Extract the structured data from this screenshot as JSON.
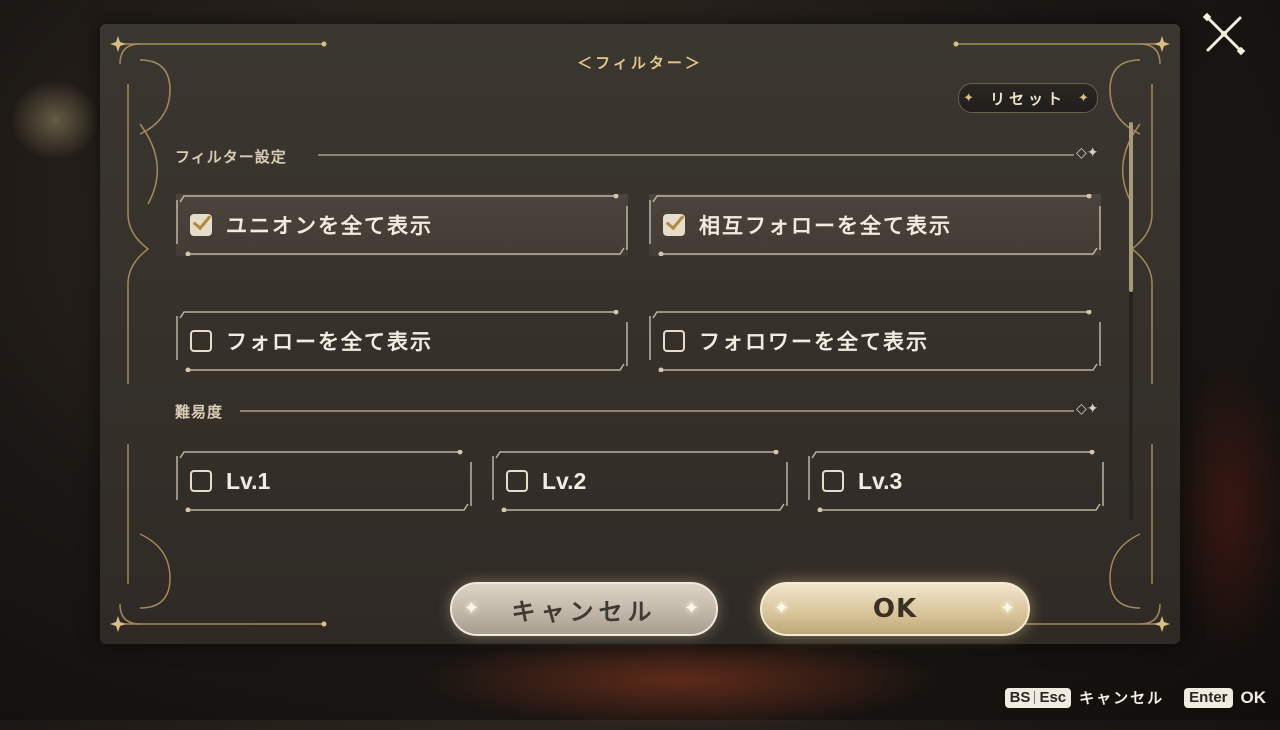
{
  "dialog": {
    "title": "＜フィルター＞",
    "reset_label": "リセット",
    "close_icon": "close-x-icon"
  },
  "sections": [
    {
      "label": "フィルター設定",
      "options": [
        {
          "label": "ユニオンを全て表示",
          "checked": true
        },
        {
          "label": "相互フォローを全て表示",
          "checked": true
        },
        {
          "label": "フォローを全て表示",
          "checked": false
        },
        {
          "label": "フォロワーを全て表示",
          "checked": false
        }
      ]
    },
    {
      "label": "難易度",
      "options": [
        {
          "label": "Lv.1",
          "checked": false
        },
        {
          "label": "Lv.2",
          "checked": false
        },
        {
          "label": "Lv.3",
          "checked": false
        }
      ]
    }
  ],
  "buttons": {
    "cancel": "キャンセル",
    "ok": "OK"
  },
  "hints": {
    "cancel_key_1": "BS",
    "cancel_key_2": "Esc",
    "cancel_text": "キャンセル",
    "ok_key": "Enter",
    "ok_text": "OK"
  },
  "colors": {
    "accent_gold": "#e3c68a",
    "panel_bg": "#37322c",
    "text_light": "#f2ece0"
  }
}
